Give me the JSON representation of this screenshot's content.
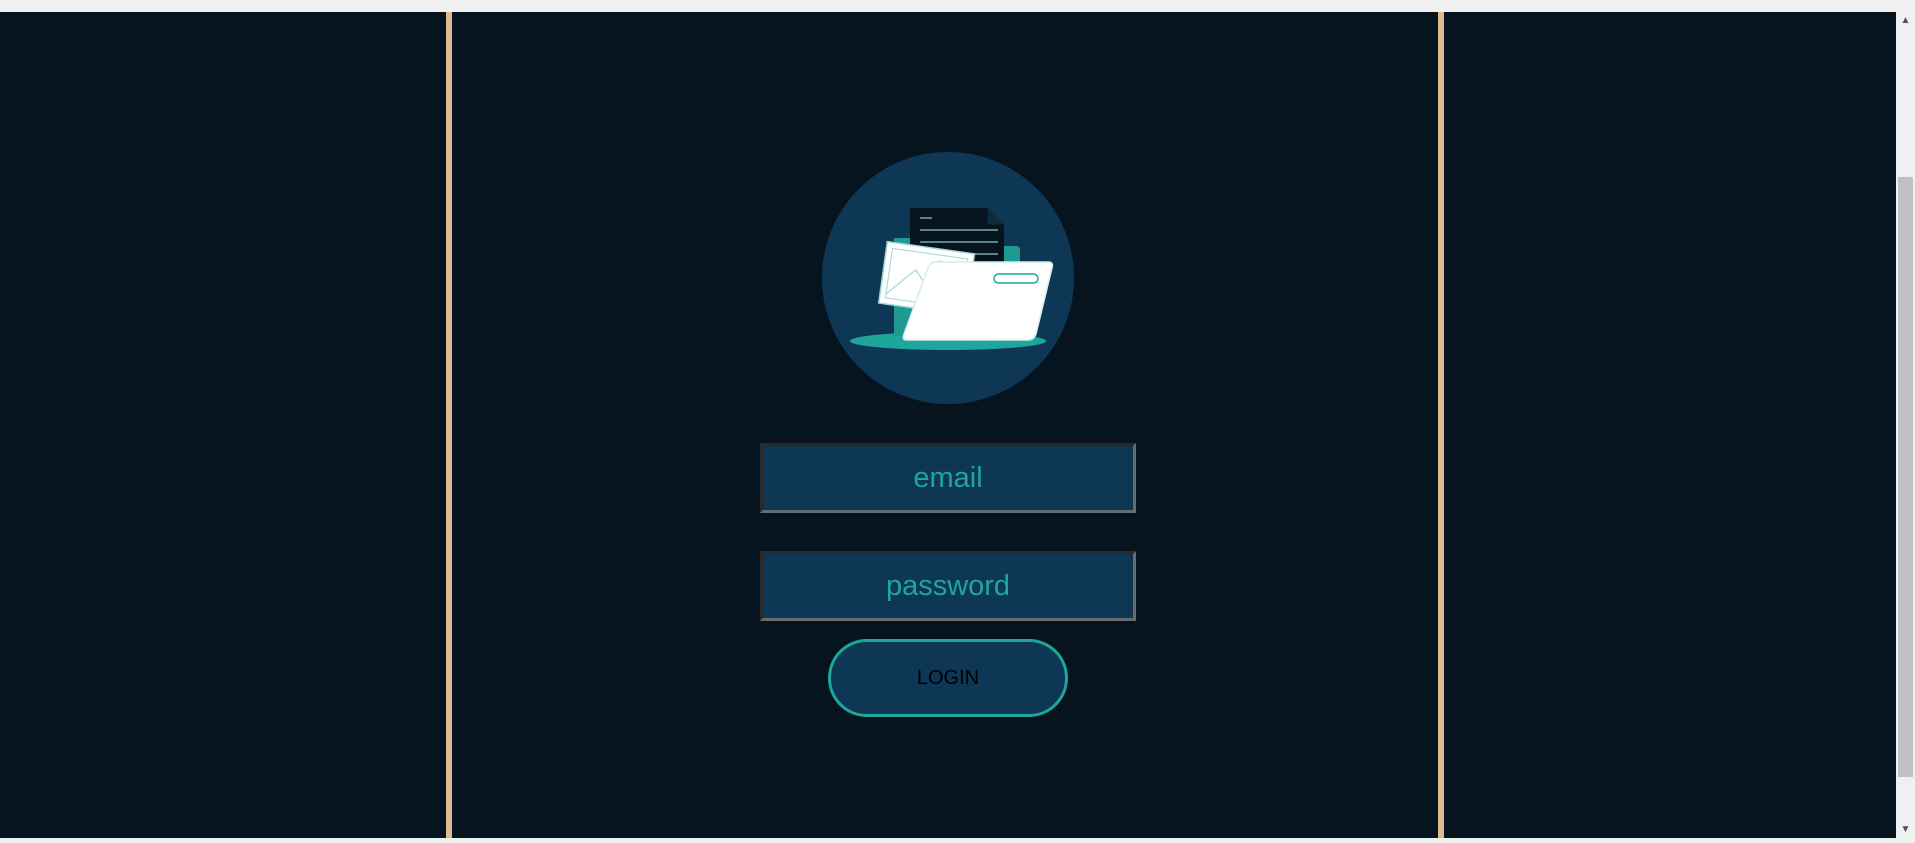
{
  "login_form": {
    "email_placeholder": "email",
    "password_placeholder": "password",
    "login_label": "LOGIN"
  },
  "logo": {
    "icon": "folder-documents-icon"
  },
  "scrollbar": {
    "up_arrow": "▲",
    "down_arrow": "▼"
  },
  "colors": {
    "background": "#061420",
    "panel_border": "#dfb98f",
    "field_background": "#0e3756",
    "accent": "#1fa69a",
    "logo_circle": "#0e3756"
  }
}
